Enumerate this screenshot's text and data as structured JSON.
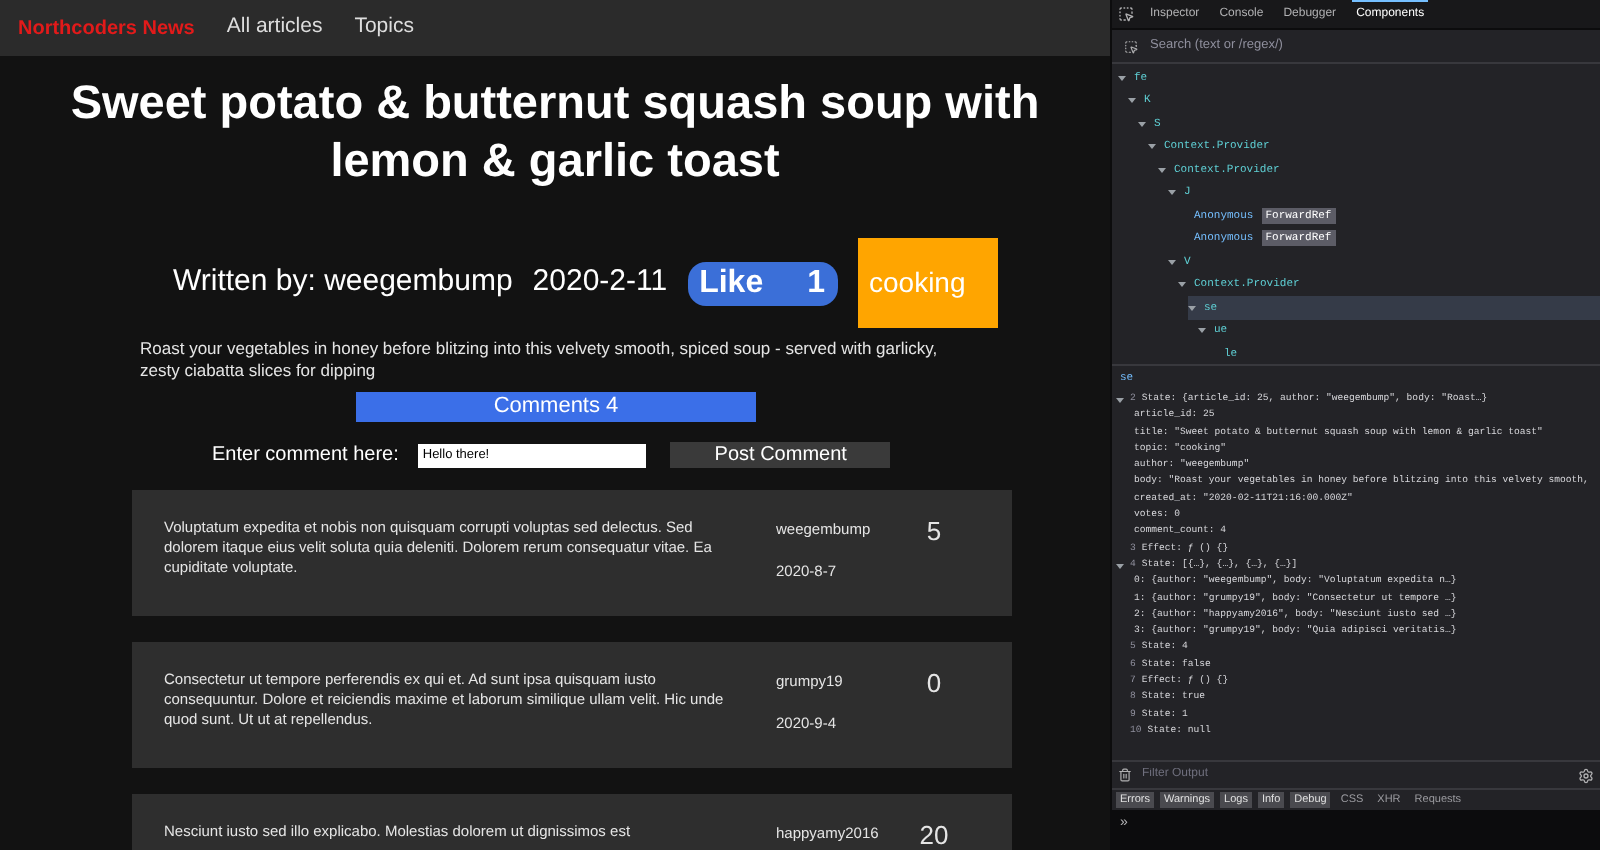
{
  "nav": {
    "brand": "Northcoders News",
    "links": [
      "All articles",
      "Topics"
    ]
  },
  "article": {
    "title": "Sweet potato & butternut squash soup with lemon & garlic toast",
    "byline": "Written by: weegembump",
    "date": "2020-2-11",
    "like_label": "Like",
    "votes": "1",
    "topic": "cooking",
    "body": "Roast your vegetables in honey before blitzing into this velvety smooth, spiced soup - served with garlicky, zesty ciabatta slices for dipping",
    "comments_button": "Comments 4",
    "comment_label": "Enter comment here:",
    "comment_value": "Hello there!",
    "post_button": "Post Comment"
  },
  "comments": [
    {
      "body": "Voluptatum expedita et nobis non quisquam corrupti voluptas sed delectus. Sed dolorem itaque eius velit soluta quia deleniti. Dolorem rerum consequatur vitae. Ea cupiditate voluptate.",
      "author": "weegembump",
      "date": "2020-8-7",
      "votes": "5"
    },
    {
      "body": "Consectetur ut tempore perferendis ex qui et. Ad sunt ipsa quisquam iusto consequuntur. Dolore et reiciendis maxime et laborum similique ullam velit. Hic unde quod sunt. Ut ut at repellendus.",
      "author": "grumpy19",
      "date": "2020-9-4",
      "votes": "0"
    },
    {
      "body": "Nesciunt iusto sed illo explicabo. Molestias dolorem ut dignissimos est",
      "author": "happyamy2016",
      "votes": "20"
    }
  ],
  "devtools": {
    "tabs": [
      {
        "label": "Inspector",
        "selected": false
      },
      {
        "label": "Console",
        "selected": false
      },
      {
        "label": "Debugger",
        "selected": false
      },
      {
        "label": "Components",
        "selected": true
      }
    ],
    "search_placeholder": "Search (text or /regex/)",
    "tree": [
      {
        "name": "fe",
        "selected": false,
        "children": [
          {
            "name": "K",
            "selected": false,
            "children": [
              {
                "name": "S",
                "selected": false,
                "children": [
                  {
                    "name": "Context.Provider",
                    "selected": false,
                    "children": [
                      {
                        "name": "Context.Provider",
                        "selected": false,
                        "children": [
                          {
                            "name": "J",
                            "selected": false,
                            "children": [
                              {
                                "name": "Anonymous",
                                "badge": "ForwardRef",
                                "selected": false
                              },
                              {
                                "name": "Anonymous",
                                "badge": "ForwardRef",
                                "selected": false
                              }
                            ]
                          },
                          {
                            "name": "V",
                            "selected": false,
                            "children": [
                              {
                                "name": "Context.Provider",
                                "selected": false,
                                "children": [
                                  {
                                    "name": "se",
                                    "selected": true,
                                    "children": [
                                      {
                                        "name": "ue",
                                        "selected": false,
                                        "children": [
                                          {
                                            "name": "le",
                                            "selected": false
                                          }
                                        ]
                                      }
                                    ]
                                  }
                                ]
                              }
                            ]
                          }
                        ]
                      }
                    ]
                  }
                ]
              }
            ]
          }
        ]
      }
    ],
    "selected_name": "se",
    "hooks": [
      {
        "num": "2",
        "text": "State: {article_id: 25, author: \"weegembump\", body: \"Roast…}",
        "expanded": true,
        "children": [
          "article_id: 25",
          "title: \"Sweet potato & butternut squash soup with lemon & garlic toast\"",
          "topic: \"cooking\"",
          "author: \"weegembump\"",
          "body: \"Roast your vegetables in honey before blitzing into this velvety smooth,",
          "created_at: \"2020-02-11T21:16:00.000Z\"",
          "votes: 0",
          "comment_count: 4"
        ]
      },
      {
        "num": "3",
        "text": "Effect: ƒ () {}",
        "expanded": false
      },
      {
        "num": "4",
        "text": "State: [{…}, {…}, {…}, {…}]",
        "expanded": true,
        "children": [
          "0: {author: \"weegembump\", body: \"Voluptatum expedita n…}",
          "1: {author: \"grumpy19\", body: \"Consectetur ut tempore …}",
          "2: {author: \"happyamy2016\", body: \"Nesciunt iusto sed …}",
          "3: {author: \"grumpy19\", body: \"Quia adipisci veritatis…}"
        ]
      },
      {
        "num": "5",
        "text": "State: 4",
        "expanded": false
      },
      {
        "num": "6",
        "text": "State: false",
        "expanded": false
      },
      {
        "num": "7",
        "text": "Effect: ƒ () {}",
        "expanded": false
      },
      {
        "num": "8",
        "text": "State: true",
        "expanded": false
      },
      {
        "num": "9",
        "text": "State: 1",
        "expanded": false
      },
      {
        "num": "10",
        "text": "State: null",
        "expanded": false
      }
    ],
    "filter_placeholder": "Filter Output",
    "console_filters": [
      {
        "label": "Errors",
        "selected": true
      },
      {
        "label": "Warnings",
        "selected": true
      },
      {
        "label": "Logs",
        "selected": true
      },
      {
        "label": "Info",
        "selected": true
      },
      {
        "label": "Debug",
        "selected": true
      },
      {
        "label": "CSS",
        "selected": false
      },
      {
        "label": "XHR",
        "selected": false
      },
      {
        "label": "Requests",
        "selected": false
      }
    ],
    "prompt": "»"
  }
}
